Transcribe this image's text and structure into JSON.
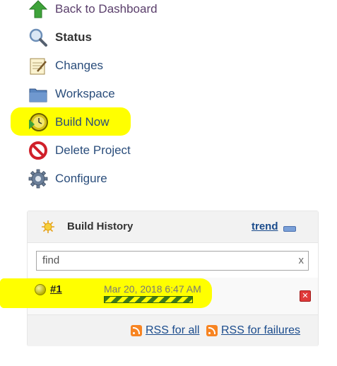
{
  "sidebar": {
    "tasks": [
      {
        "label": "Back to Dashboard",
        "icon": "up-arrow-icon"
      },
      {
        "label": "Status",
        "icon": "magnifier-icon"
      },
      {
        "label": "Changes",
        "icon": "notepad-icon"
      },
      {
        "label": "Workspace",
        "icon": "folder-icon"
      },
      {
        "label": "Build Now",
        "icon": "clock-play-icon"
      },
      {
        "label": "Delete Project",
        "icon": "no-entry-icon"
      },
      {
        "label": "Configure",
        "icon": "gear-icon"
      }
    ]
  },
  "build_history": {
    "title": "Build History",
    "trend_label": "trend",
    "search_value": "find",
    "search_clear": "x",
    "builds": [
      {
        "number": "#1",
        "timestamp": "Mar 20, 2018 6:47 AM",
        "status_color": "#c8c800"
      }
    ],
    "rss_all": "RSS for all",
    "rss_failures": "RSS for failures"
  },
  "colors": {
    "highlight": "#ffff00",
    "link": "#1a4b8c",
    "rss": "#f78422"
  }
}
